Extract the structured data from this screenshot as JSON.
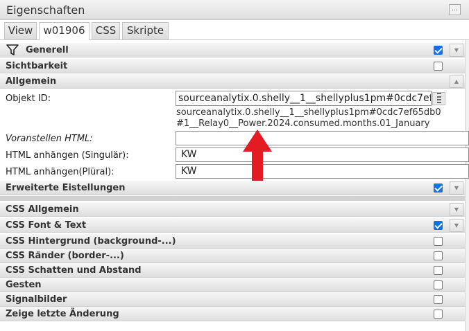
{
  "panel": {
    "title": "Eigenschaften",
    "menu_glyph": "…"
  },
  "tabs": [
    {
      "label": "View"
    },
    {
      "label": "w01906",
      "active": true
    },
    {
      "label": "CSS"
    },
    {
      "label": "Skripte"
    }
  ],
  "groups": {
    "generell": {
      "label": "Generell",
      "checked": true,
      "icon": "filter-icon"
    },
    "sichtbarkeit": {
      "label": "Sichtbarkeit",
      "checked": false
    },
    "allgemein": {
      "label": "Allgemein"
    },
    "erweitert": {
      "label": "Erweiterte Eistellungen",
      "checked": true
    },
    "css_allgemein": {
      "label": "CSS Allgemein"
    },
    "css_font": {
      "label": "CSS Font & Text",
      "checked": true
    },
    "css_hintergrund": {
      "label": "CSS Hintergrund (background-...)",
      "checked": false
    },
    "css_raender": {
      "label": "CSS Ränder (border-...)",
      "checked": false
    },
    "css_schatten": {
      "label": "CSS Schatten und Abstand",
      "checked": false
    },
    "gesten": {
      "label": "Gesten",
      "checked": false
    },
    "signalbilder": {
      "label": "Signalbilder",
      "checked": false
    },
    "letzte_aenderung": {
      "label": "Zeige letzte Änderung",
      "checked": false
    }
  },
  "allgemein": {
    "objekt_id_label": "Objekt ID:",
    "objekt_id_value": "sourceanalytix.0.shelly__1__shellyplus1pm#0cdc7ef65",
    "objekt_id_full_line1": "sourceanalytix.0.shelly__1__shellyplus1pm#0cdc7ef65db0",
    "objekt_id_full_line2": "#1__Relay0__Power.2024.consumed.months.01_January",
    "voranstellen_label": "Voranstellen HTML:",
    "voranstellen_value": "",
    "anhaengen_singular_label": "HTML anhängen (Singulär):",
    "anhaengen_singular_value": "KW",
    "anhaengen_plural_label": "HTML anhängen(Plüral):",
    "anhaengen_plural_value": "KW"
  },
  "annotation": {
    "arrow_color": "#e31b23",
    "icon": "red-arrow-up-icon"
  },
  "colors": {
    "checkbox": "#0b72e7",
    "header_bg": "#e4e4e4"
  }
}
